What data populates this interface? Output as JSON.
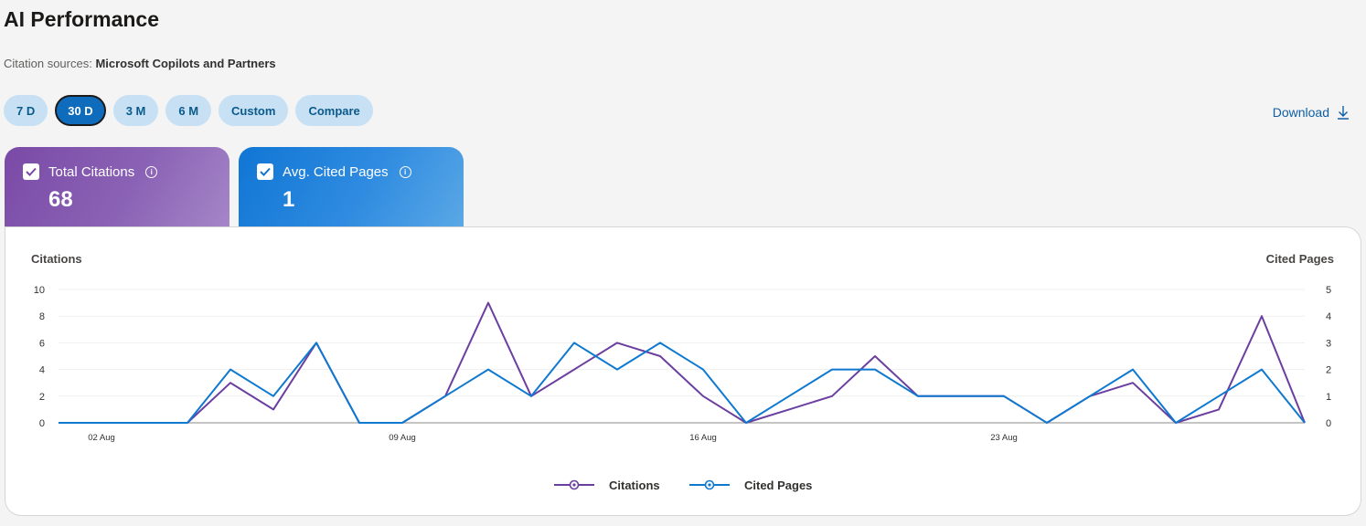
{
  "page": {
    "title": "AI Performance",
    "sources_label": "Citation sources:",
    "sources_value": "Microsoft Copilots and Partners"
  },
  "filters": {
    "items": [
      {
        "label": "7 D",
        "active": false
      },
      {
        "label": "30 D",
        "active": true
      },
      {
        "label": "3 M",
        "active": false
      },
      {
        "label": "6 M",
        "active": false
      },
      {
        "label": "Custom",
        "active": false
      },
      {
        "label": "Compare",
        "active": false
      }
    ]
  },
  "download": {
    "label": "Download",
    "icon": "download-arrow-icon"
  },
  "cards": [
    {
      "label": "Total Citations",
      "value": "68",
      "checked": true,
      "color": "#7a4aa6"
    },
    {
      "label": "Avg. Cited Pages",
      "value": "1",
      "checked": true,
      "color": "#1076d4"
    }
  ],
  "chart_data": {
    "type": "line",
    "left_axis_label": "Citations",
    "right_axis_label": "Cited Pages",
    "left_ylim": [
      0,
      10
    ],
    "right_ylim": [
      0,
      5
    ],
    "left_ticks": [
      "0",
      "2",
      "4",
      "6",
      "8",
      "10"
    ],
    "right_ticks": [
      "0",
      "1",
      "2",
      "3",
      "4",
      "5"
    ],
    "x_tick_labels": [
      {
        "index": 1,
        "label": "02 Aug"
      },
      {
        "index": 8,
        "label": "09 Aug"
      },
      {
        "index": 15,
        "label": "16 Aug"
      },
      {
        "index": 22,
        "label": "23 Aug"
      }
    ],
    "point_count": 29,
    "grid": true,
    "legend_position": "bottom",
    "series": [
      {
        "name": "Citations",
        "axis": "left",
        "color": "#6b3fa0",
        "values": [
          0,
          0,
          0,
          0,
          3,
          1,
          6,
          0,
          0,
          2,
          9,
          2,
          4,
          6,
          5,
          2,
          0,
          1,
          2,
          5,
          2,
          2,
          2,
          0,
          2,
          3,
          0,
          1,
          8,
          0
        ]
      },
      {
        "name": "Cited Pages",
        "axis": "right",
        "color": "#0f79d0",
        "values": [
          0,
          0,
          0,
          0,
          2,
          1,
          3,
          0,
          0,
          1,
          2,
          1,
          3,
          2,
          3,
          2,
          0,
          1,
          2,
          2,
          1,
          1,
          1,
          0,
          1,
          2,
          0,
          1,
          2,
          0
        ]
      }
    ]
  }
}
